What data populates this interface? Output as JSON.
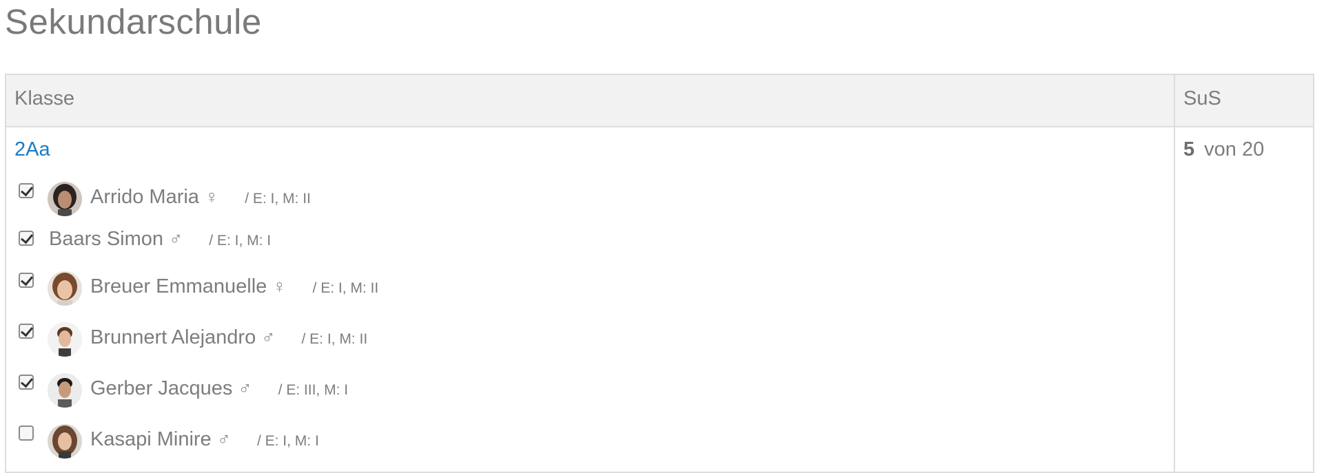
{
  "page": {
    "title": "Sekundarschule"
  },
  "table": {
    "headers": {
      "klasse": "Klasse",
      "sus": "SuS"
    },
    "class_name": "2Aa",
    "sus_selected": "5",
    "sus_total": "von 20",
    "students": [
      {
        "name": "Arrido Maria",
        "gender": "♀",
        "levels": "/ E: I, M: II",
        "checked": true,
        "avatar": "avatar-female-dark-hair"
      },
      {
        "name": "Baars Simon",
        "gender": "♂",
        "levels": "/ E: I, M: I",
        "checked": true,
        "avatar": null
      },
      {
        "name": "Breuer Emmanuelle",
        "gender": "♀",
        "levels": "/ E: I, M: II",
        "checked": true,
        "avatar": "avatar-female-light-hair"
      },
      {
        "name": "Brunnert Alejandro",
        "gender": "♂",
        "levels": "/ E: I, M: II",
        "checked": true,
        "avatar": "avatar-male-brown-hair"
      },
      {
        "name": "Gerber Jacques",
        "gender": "♂",
        "levels": "/ E: III, M: I",
        "checked": true,
        "avatar": "avatar-male-dark-hair"
      },
      {
        "name": "Kasapi Minire",
        "gender": "♂",
        "levels": "/ E: I, M: I",
        "checked": false,
        "avatar": "avatar-female-long-hair"
      }
    ]
  }
}
